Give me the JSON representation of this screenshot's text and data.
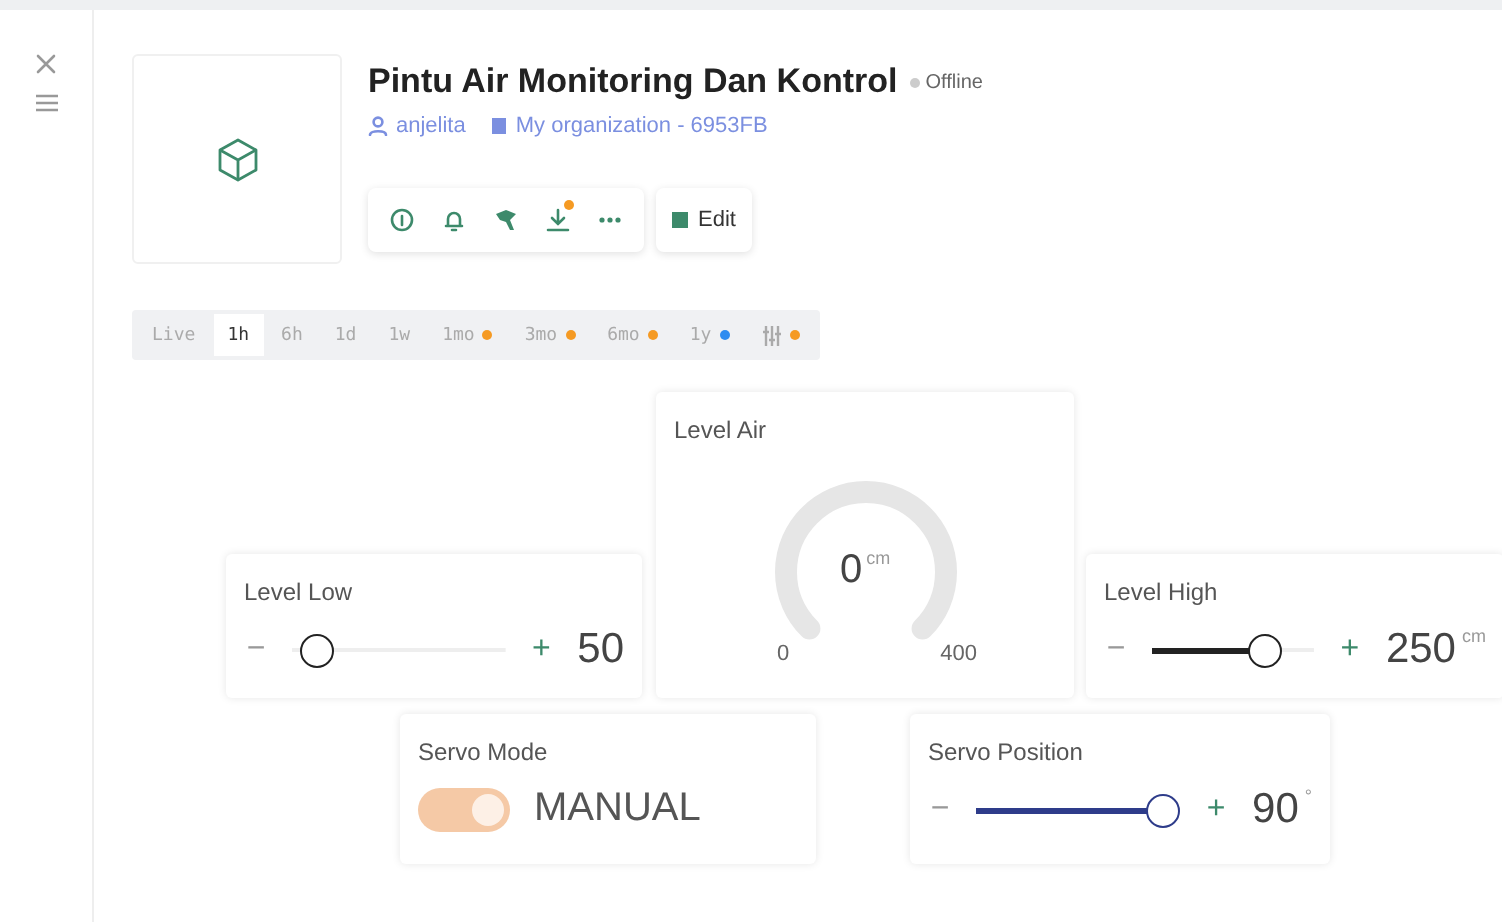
{
  "device": {
    "title": "Pintu Air Monitoring Dan Kontrol",
    "status": "Offline",
    "owner": "anjelita",
    "organization": "My organization - 6953FB",
    "edit_label": "Edit",
    "download_badge": true
  },
  "time_tabs": [
    {
      "label": "Live",
      "selected": false
    },
    {
      "label": "1h",
      "selected": true
    },
    {
      "label": "6h",
      "selected": false
    },
    {
      "label": "1d",
      "selected": false
    },
    {
      "label": "1w",
      "selected": false
    },
    {
      "label": "1mo",
      "selected": false,
      "color": "#f59a23"
    },
    {
      "label": "3mo",
      "selected": false,
      "color": "#f59a23"
    },
    {
      "label": "6mo",
      "selected": false,
      "color": "#f59a23"
    },
    {
      "label": "1y",
      "selected": false,
      "color": "#2f8cf0"
    },
    {
      "kind": "filter",
      "selected": false,
      "color": "#f59a23"
    }
  ],
  "widgets": [
    {
      "kind": "slider",
      "title": "Level Low",
      "minus": "−",
      "plus": "+",
      "value": "50",
      "level": 0.05,
      "color": "#222222"
    },
    {
      "kind": "gauge",
      "title": "Level Air",
      "value": "0",
      "unit": "cm",
      "min": "0",
      "max": "400"
    },
    {
      "kind": "slider",
      "title": "Level High",
      "minus": "−",
      "plus": "+",
      "value": "250",
      "unit": "cm",
      "level": 0.75,
      "color": "#222222"
    },
    {
      "kind": "switch",
      "title": "Servo Mode",
      "label": "MANUAL",
      "on": true
    },
    {
      "kind": "slider",
      "title": "Servo Position",
      "minus": "−",
      "plus": "+",
      "value": "90",
      "unit": "°",
      "level": 1,
      "color": "#2e3c8a"
    }
  ]
}
